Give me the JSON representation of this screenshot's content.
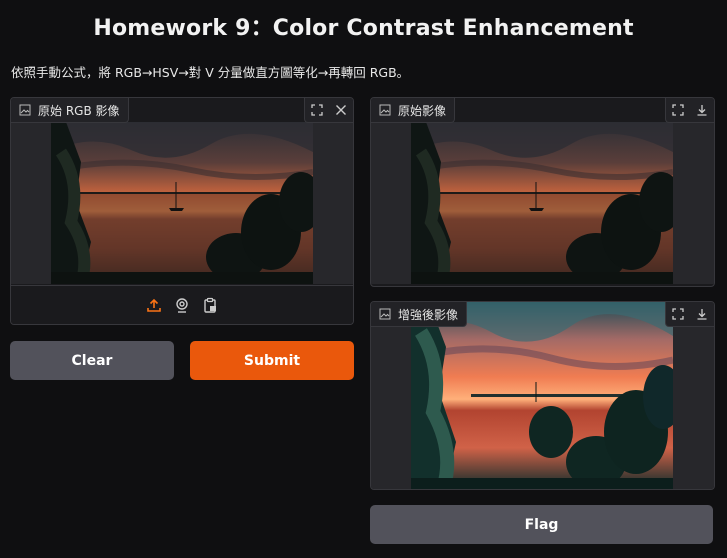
{
  "page": {
    "title": "Homework 9：Color Contrast Enhancement",
    "description": "依照手動公式，將 RGB→HSV→對 V 分量做直方圖等化→再轉回 RGB。"
  },
  "input_panel": {
    "label": "原始 RGB 影像",
    "icons": [
      "image-icon",
      "fullscreen-icon",
      "close-icon",
      "upload-icon",
      "webcam-icon",
      "clipboard-icon"
    ]
  },
  "output_original": {
    "label": "原始影像",
    "icons": [
      "image-icon",
      "fullscreen-icon",
      "download-icon"
    ]
  },
  "output_enhanced": {
    "label": "增強後影像",
    "icons": [
      "image-icon",
      "fullscreen-icon",
      "download-icon"
    ]
  },
  "buttons": {
    "clear": "Clear",
    "submit": "Submit",
    "flag": "Flag"
  },
  "colors": {
    "accent": "#ea580c",
    "upload_icon": "#f97316",
    "secondary_button": "#52525b",
    "background": "#0f0f11"
  }
}
